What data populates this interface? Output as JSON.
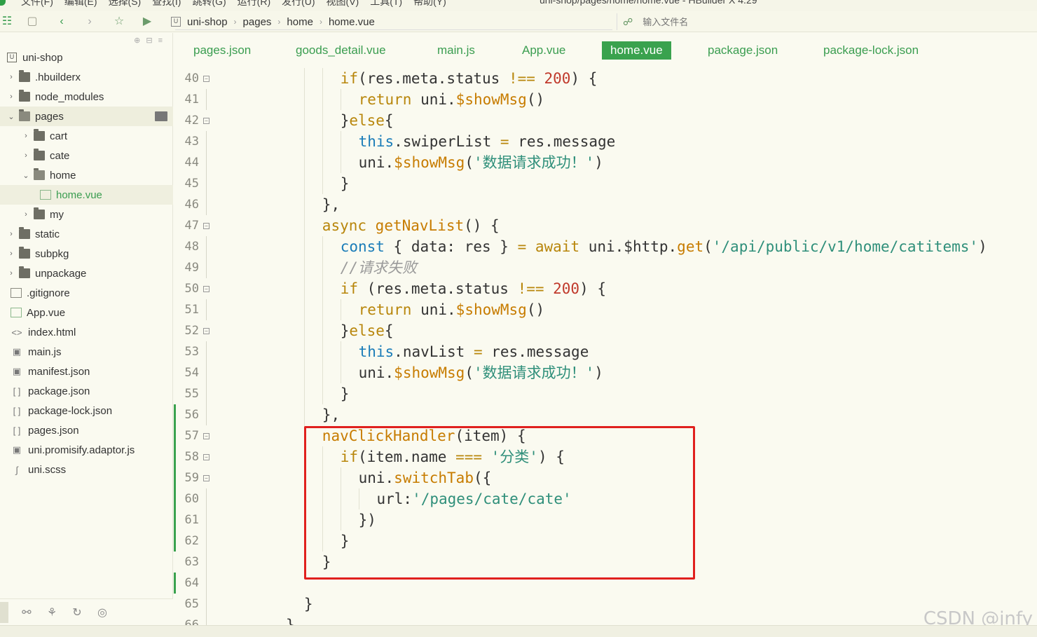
{
  "window": {
    "menus": [
      "文件(F)",
      "编辑(E)",
      "选择(S)",
      "查找(I)",
      "跳转(G)",
      "运行(R)",
      "发行(U)",
      "视图(V)",
      "工具(T)",
      "帮助(Y)"
    ],
    "title": "uni-shop/pages/home/home.vue - HBuilder X 4.29"
  },
  "toolbar": {
    "breadcrumb": [
      "uni-shop",
      "pages",
      "home",
      "home.vue"
    ],
    "file_search_placeholder": "输入文件名"
  },
  "sidebar": {
    "tree": [
      {
        "label": "uni-shop",
        "type": "project",
        "depth": 0
      },
      {
        "label": ".hbuilderx",
        "type": "folder",
        "depth": 1,
        "expanded": false
      },
      {
        "label": "node_modules",
        "type": "folder",
        "depth": 1,
        "expanded": false
      },
      {
        "label": "pages",
        "type": "folder",
        "depth": 1,
        "expanded": true,
        "selected": true
      },
      {
        "label": "cart",
        "type": "folder",
        "depth": 2,
        "expanded": false
      },
      {
        "label": "cate",
        "type": "folder",
        "depth": 2,
        "expanded": false
      },
      {
        "label": "home",
        "type": "folder",
        "depth": 2,
        "expanded": true
      },
      {
        "label": "home.vue",
        "type": "vue",
        "depth": 3,
        "active": true
      },
      {
        "label": "my",
        "type": "folder",
        "depth": 2,
        "expanded": false
      },
      {
        "label": "static",
        "type": "folder",
        "depth": 1,
        "expanded": false
      },
      {
        "label": "subpkg",
        "type": "folder",
        "depth": 1,
        "expanded": false
      },
      {
        "label": "unpackage",
        "type": "folder",
        "depth": 1,
        "expanded": false
      },
      {
        "label": ".gitignore",
        "type": "file",
        "depth": 1
      },
      {
        "label": "App.vue",
        "type": "vue",
        "depth": 1
      },
      {
        "label": "index.html",
        "type": "html",
        "depth": 1
      },
      {
        "label": "main.js",
        "type": "js",
        "depth": 1
      },
      {
        "label": "manifest.json",
        "type": "manifest",
        "depth": 1
      },
      {
        "label": "package.json",
        "type": "json",
        "depth": 1
      },
      {
        "label": "package-lock.json",
        "type": "json",
        "depth": 1
      },
      {
        "label": "pages.json",
        "type": "json",
        "depth": 1
      },
      {
        "label": "uni.promisify.adaptor.js",
        "type": "js",
        "depth": 1
      },
      {
        "label": "uni.scss",
        "type": "scss",
        "depth": 1
      }
    ]
  },
  "tabs": [
    {
      "label": "pages.json"
    },
    {
      "label": "goods_detail.vue"
    },
    {
      "label": "main.js"
    },
    {
      "label": "App.vue"
    },
    {
      "label": "home.vue",
      "active": true
    },
    {
      "label": "package.json"
    },
    {
      "label": "package-lock.json"
    }
  ],
  "editor": {
    "lines": [
      {
        "n": "40",
        "fold": true,
        "indent": 6,
        "tokens": [
          [
            "kw",
            "if"
          ],
          [
            "",
            "("
          ],
          [
            "",
            "res.meta.status "
          ],
          [
            "op",
            "!=="
          ],
          [
            "",
            ""
          ],
          [
            "num",
            " 200"
          ],
          [
            "",
            ") {"
          ]
        ]
      },
      {
        "n": "41",
        "indent": 8,
        "tokens": [
          [
            "kw",
            "return"
          ],
          [
            "",
            " uni."
          ],
          [
            "fn",
            "$showMsg"
          ],
          [
            "",
            "()"
          ]
        ]
      },
      {
        "n": "42",
        "fold": true,
        "indent": 6,
        "tokens": [
          [
            "",
            "}"
          ],
          [
            "kw",
            "else"
          ],
          [
            "",
            "{"
          ]
        ]
      },
      {
        "n": "43",
        "indent": 8,
        "tokens": [
          [
            "kw2",
            "this"
          ],
          [
            "",
            ".swiperList "
          ],
          [
            "op",
            "="
          ],
          [
            "",
            " res.message"
          ]
        ]
      },
      {
        "n": "44",
        "indent": 8,
        "tokens": [
          [
            "",
            "uni."
          ],
          [
            "fn",
            "$showMsg"
          ],
          [
            "",
            "("
          ],
          [
            "str",
            "'数据请求成功！'"
          ],
          [
            "",
            ")"
          ]
        ]
      },
      {
        "n": "45",
        "indent": 6,
        "tokens": [
          [
            "",
            "}"
          ]
        ]
      },
      {
        "n": "46",
        "indent": 4,
        "tokens": [
          [
            "",
            "},"
          ]
        ]
      },
      {
        "n": "47",
        "fold": true,
        "indent": 4,
        "tokens": [
          [
            "kw",
            "async"
          ],
          [
            "",
            " "
          ],
          [
            "fn",
            "getNavList"
          ],
          [
            "",
            "() {"
          ]
        ]
      },
      {
        "n": "48",
        "indent": 6,
        "tokens": [
          [
            "kw2",
            "const"
          ],
          [
            "",
            " { data: res } "
          ],
          [
            "op",
            "="
          ],
          [
            "",
            " "
          ],
          [
            "kw",
            "await"
          ],
          [
            "",
            " uni.$http."
          ],
          [
            "fn",
            "get"
          ],
          [
            "",
            "("
          ],
          [
            "str",
            "'/api/public/v1/home/catitems'"
          ],
          [
            "",
            ")"
          ]
        ]
      },
      {
        "n": "49",
        "indent": 6,
        "tokens": [
          [
            "cmt",
            "//请求失败"
          ]
        ]
      },
      {
        "n": "50",
        "fold": true,
        "indent": 6,
        "tokens": [
          [
            "kw",
            "if"
          ],
          [
            "",
            " (res.meta.status "
          ],
          [
            "op",
            "!=="
          ],
          [
            "num",
            " 200"
          ],
          [
            "",
            ") {"
          ]
        ]
      },
      {
        "n": "51",
        "indent": 8,
        "tokens": [
          [
            "kw",
            "return"
          ],
          [
            "",
            " uni."
          ],
          [
            "fn",
            "$showMsg"
          ],
          [
            "",
            "()"
          ]
        ]
      },
      {
        "n": "52",
        "fold": true,
        "indent": 6,
        "tokens": [
          [
            "",
            "}"
          ],
          [
            "kw",
            "else"
          ],
          [
            "",
            "{"
          ]
        ]
      },
      {
        "n": "53",
        "indent": 8,
        "tokens": [
          [
            "kw2",
            "this"
          ],
          [
            "",
            ".navList "
          ],
          [
            "op",
            "="
          ],
          [
            "",
            " res.message"
          ]
        ]
      },
      {
        "n": "54",
        "indent": 8,
        "tokens": [
          [
            "",
            "uni."
          ],
          [
            "fn",
            "$showMsg"
          ],
          [
            "",
            "("
          ],
          [
            "str",
            "'数据请求成功！'"
          ],
          [
            "",
            ")"
          ]
        ]
      },
      {
        "n": "55",
        "indent": 6,
        "tokens": [
          [
            "",
            "}"
          ]
        ]
      },
      {
        "n": "56",
        "indent": 4,
        "tokens": [
          [
            "",
            "},"
          ]
        ]
      },
      {
        "n": "57",
        "fold": true,
        "indent": 4,
        "tokens": [
          [
            "fn",
            "navClickHandler"
          ],
          [
            "",
            "(item) {"
          ]
        ]
      },
      {
        "n": "58",
        "fold": true,
        "indent": 6,
        "tokens": [
          [
            "kw",
            "if"
          ],
          [
            "",
            "(item.name "
          ],
          [
            "op",
            "==="
          ],
          [
            "",
            " "
          ],
          [
            "str",
            "'分类'"
          ],
          [
            "",
            ") {"
          ]
        ]
      },
      {
        "n": "59",
        "fold": true,
        "indent": 8,
        "tokens": [
          [
            "",
            "uni."
          ],
          [
            "fn",
            "switchTab"
          ],
          [
            "",
            "({"
          ]
        ]
      },
      {
        "n": "60",
        "indent": 10,
        "tokens": [
          [
            "",
            "url:"
          ],
          [
            "str",
            "'/pages/cate/cate'"
          ]
        ]
      },
      {
        "n": "61",
        "indent": 8,
        "tokens": [
          [
            "",
            "})"
          ]
        ]
      },
      {
        "n": "62",
        "indent": 6,
        "tokens": [
          [
            "",
            "}"
          ]
        ]
      },
      {
        "n": "63",
        "indent": 4,
        "tokens": [
          [
            "",
            "}"
          ]
        ]
      },
      {
        "n": "64",
        "indent": 0,
        "tokens": []
      },
      {
        "n": "65",
        "indent": 2,
        "tokens": [
          [
            "",
            "}"
          ]
        ]
      },
      {
        "n": "66",
        "indent": 0,
        "tokens": [
          [
            "",
            "}"
          ]
        ]
      }
    ]
  },
  "watermark": "CSDN @jnfy",
  "colors": {
    "accent": "#3aa24e",
    "highlight": "#e0201e"
  }
}
